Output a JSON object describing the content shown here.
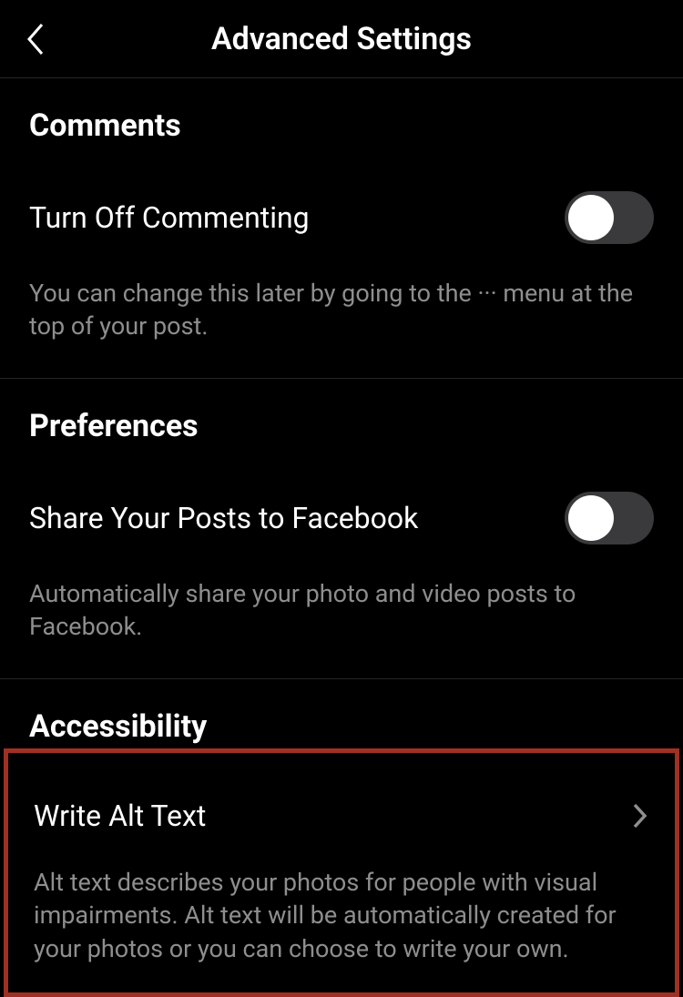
{
  "header": {
    "title": "Advanced Settings"
  },
  "sections": {
    "comments": {
      "title": "Comments",
      "toggle_label": "Turn Off Commenting",
      "description": "You can change this later by going to the ··· menu at the top of your post."
    },
    "preferences": {
      "title": "Preferences",
      "toggle_label": "Share Your Posts to Facebook",
      "description": "Automatically share your photo and video posts to Facebook."
    },
    "accessibility": {
      "title": "Accessibility",
      "nav_label": "Write Alt Text",
      "description": "Alt text describes your photos for people with visual impairments. Alt text will be automatically created for your photos or you can choose to write your own."
    }
  }
}
